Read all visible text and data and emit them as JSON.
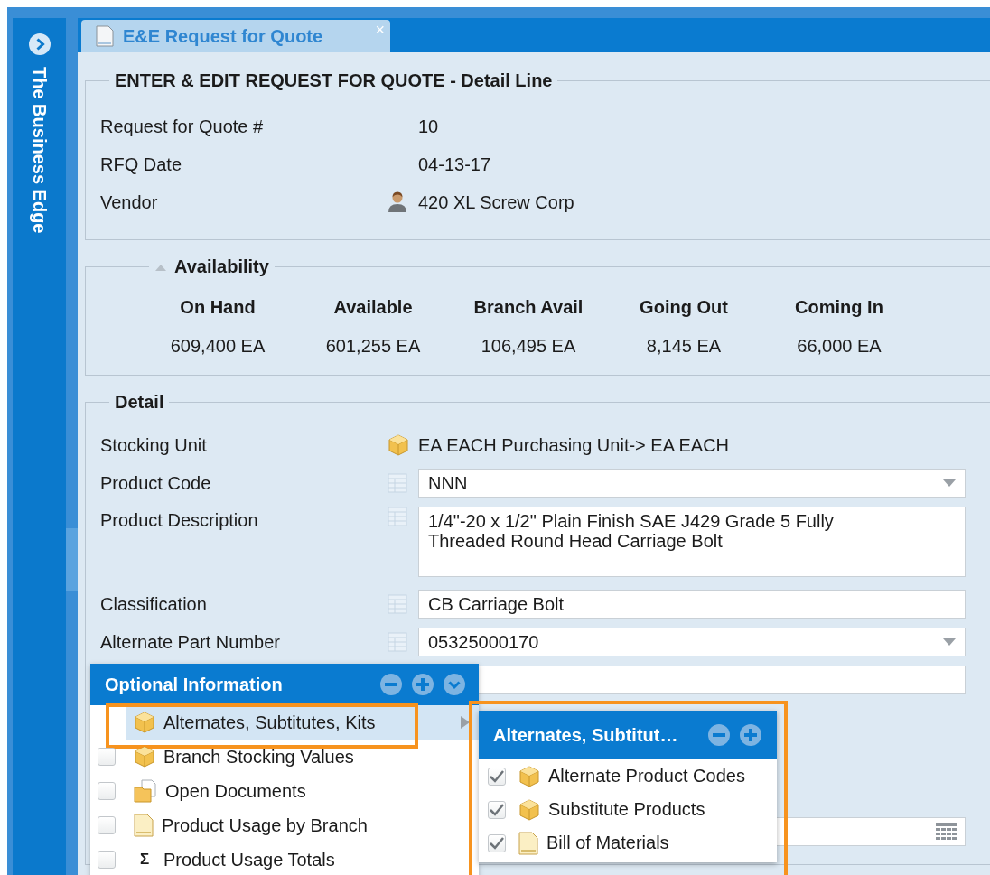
{
  "sidebar": {
    "title": "The Business Edge"
  },
  "tabs": [
    {
      "label": "E&E Request for Quote",
      "close": "×",
      "selected": true
    }
  ],
  "header": {
    "title": "ENTER & EDIT REQUEST FOR QUOTE - Detail Line",
    "fields": [
      {
        "label": "Request for Quote #",
        "value": "10",
        "kind": "plain"
      },
      {
        "label": "RFQ Date",
        "value": "04-13-17",
        "kind": "plain"
      },
      {
        "label": "Vendor",
        "value": "420 XL Screw Corp",
        "kind": "vendor"
      }
    ]
  },
  "availability": {
    "title": "Availability",
    "expanded": true,
    "columns": [
      {
        "label": "On Hand",
        "value": "609,400 EA"
      },
      {
        "label": "Available",
        "value": "601,255 EA"
      },
      {
        "label": "Branch Avail",
        "value": "106,495 EA"
      },
      {
        "label": "Going Out",
        "value": "8,145 EA"
      },
      {
        "label": "Coming In",
        "value": "66,000 EA"
      }
    ]
  },
  "detail": {
    "title": "Detail",
    "fields": [
      {
        "label": "Stocking Unit",
        "kind": "unit",
        "value": "EA EACH Purchasing Unit-> EA EACH"
      },
      {
        "label": "Product Code",
        "kind": "select",
        "value": "NNN"
      },
      {
        "label": "Product Description",
        "kind": "textarea",
        "value": "1/4\"-20 x 1/2\" Plain Finish SAE J429 Grade 5 Fully Threaded Round Head Carriage Bolt"
      },
      {
        "label": "Classification",
        "kind": "text",
        "value": "CB Carriage Bolt"
      },
      {
        "label": "Alternate Part Number",
        "kind": "select",
        "value": "05325000170"
      },
      {
        "kind": "text"
      },
      {
        "kind": "grid"
      }
    ]
  },
  "optional_menu": {
    "title": "Optional Information",
    "items": [
      {
        "label": "Alternates, Subtitutes, Kits",
        "kind": "box",
        "selected": true,
        "highlighted": true,
        "submenu": true
      },
      {
        "label": "Branch Stocking Values",
        "kind": "box",
        "selected": false,
        "highlighted": false,
        "submenu": false,
        "checked": false
      },
      {
        "label": "Open Documents",
        "kind": "folder",
        "selected": false,
        "highlighted": false,
        "submenu": false,
        "checked": false
      },
      {
        "label": "Product Usage by Branch",
        "kind": "doc",
        "selected": false,
        "highlighted": false,
        "submenu": false,
        "checked": false
      },
      {
        "label": "Product Usage Totals",
        "kind": "sigma",
        "symbol": "Σ",
        "selected": false,
        "highlighted": false,
        "submenu": false,
        "checked": false
      }
    ]
  },
  "submenu": {
    "title": "Alternates, Subtitut…",
    "highlighted": true,
    "items": [
      {
        "label": "Alternate Product Codes",
        "kind": "box",
        "checked": true
      },
      {
        "label": "Substitute Products",
        "kind": "box",
        "checked": true
      },
      {
        "label": "Bill of Materials",
        "kind": "doc",
        "checked": true
      }
    ]
  }
}
